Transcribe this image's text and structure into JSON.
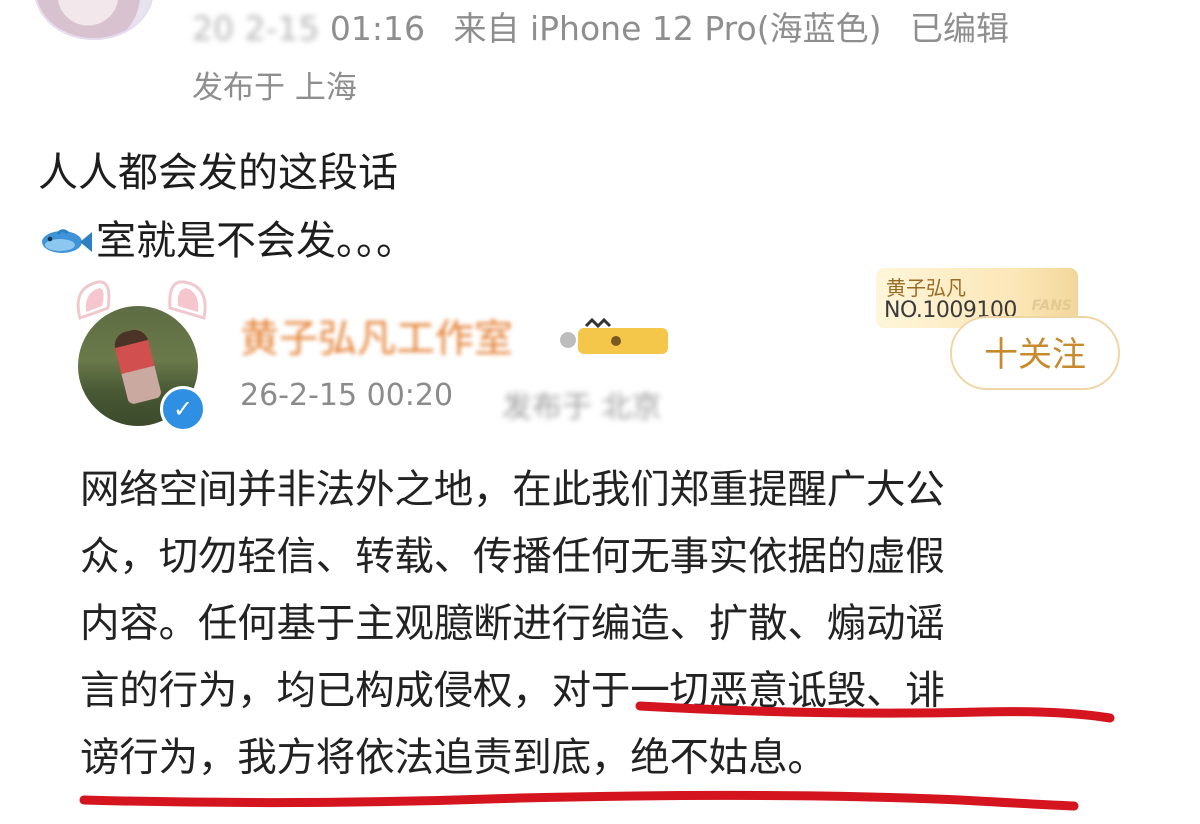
{
  "post": {
    "time_blurred": "20 2-15",
    "time_clock": " 01:16",
    "source": "来自 iPhone 12 Pro(海蓝色)",
    "edited": "已编辑",
    "location": "发布于 上海",
    "text_line1": "人人都会发的这段话",
    "text_line2": "室就是不会发。。。",
    "fish_icon": "fish-icon"
  },
  "quoted": {
    "name": "黄子弘凡工作室",
    "time": "26-2-15 00:20",
    "location": "发布于 北京",
    "follow_label": "十关注",
    "fan_card": {
      "name": "黄子弘凡",
      "number": "NO.1009100",
      "mark": "FANS"
    },
    "body": [
      "网络空间并非法外之地，在此我们郑重提醒广大公",
      "众，切勿轻信、转载、传播任何无事实依据的虚假",
      "内容。任何基于主观臆断进行编造、扩散、煽动谣",
      "言的行为，均已构成侵权，对于一切恶意诋毁、诽",
      "谤行为，我方将依法追责到底，绝不姑息。"
    ]
  },
  "colors": {
    "accent_name": "#e0731f",
    "follow": "#c88a2c",
    "verified": "#2e8fe3",
    "annotation": "#d4141e"
  }
}
